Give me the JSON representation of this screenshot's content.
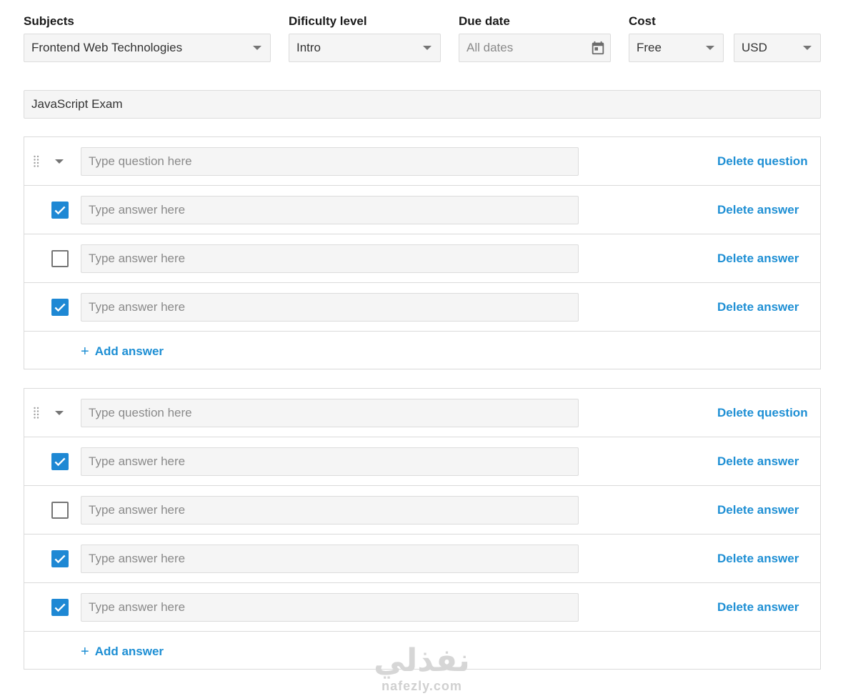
{
  "filters": {
    "subjects": {
      "label": "Subjects",
      "value": "Frontend Web Technologies"
    },
    "difficulty": {
      "label": "Dificulty level",
      "value": "Intro"
    },
    "due_date": {
      "label": "Due date",
      "placeholder": "All dates"
    },
    "cost": {
      "label": "Cost",
      "value": "Free"
    },
    "currency": {
      "value": "USD"
    }
  },
  "exam_title": "JavaScript Exam",
  "colors": {
    "accent": "#1e8fd4",
    "checkbox": "#1e88d4"
  },
  "questions": [
    {
      "placeholder": "Type question here",
      "delete_label": "Delete question",
      "answers": [
        {
          "checked": true,
          "placeholder": "Type answer here",
          "delete_label": "Delete answer"
        },
        {
          "checked": false,
          "placeholder": "Type answer here",
          "delete_label": "Delete answer"
        },
        {
          "checked": true,
          "placeholder": "Type answer here",
          "delete_label": "Delete answer"
        }
      ],
      "add_label": "Add answer"
    },
    {
      "placeholder": "Type question here",
      "delete_label": "Delete question",
      "answers": [
        {
          "checked": true,
          "placeholder": "Type answer here",
          "delete_label": "Delete answer"
        },
        {
          "checked": false,
          "placeholder": "Type answer here",
          "delete_label": "Delete answer"
        },
        {
          "checked": true,
          "placeholder": "Type answer here",
          "delete_label": "Delete answer"
        },
        {
          "checked": true,
          "placeholder": "Type answer here",
          "delete_label": "Delete answer"
        }
      ],
      "add_label": "Add answer"
    }
  ],
  "watermark": {
    "arabic": "نفذلي",
    "latin": "nafezly.com"
  }
}
